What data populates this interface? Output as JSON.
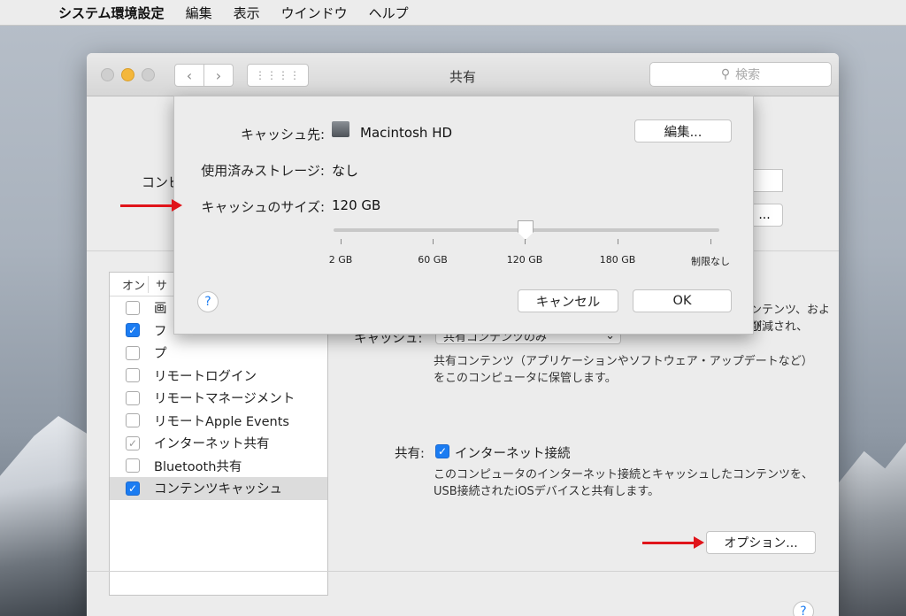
{
  "menubar": {
    "apple_icon": "apple-icon",
    "app_name": "システム環境設定",
    "items": [
      "編集",
      "表示",
      "ウインドウ",
      "ヘルプ"
    ]
  },
  "window": {
    "title": "共有",
    "search_placeholder": "検索",
    "computer_name_label": "コンピ",
    "edit_behind": "..."
  },
  "services": {
    "header_on": "オン",
    "header_service": "サ",
    "items": [
      {
        "label": "画",
        "checked": false
      },
      {
        "label": "フ",
        "checked": true
      },
      {
        "label": "プ",
        "checked": false
      },
      {
        "label": "リモートログイン",
        "checked": false
      },
      {
        "label": "リモートマネージメント",
        "checked": false
      },
      {
        "label": "リモートApple Events",
        "checked": false
      },
      {
        "label": "インターネット共有",
        "checked": true
      },
      {
        "label": "Bluetooth共有",
        "checked": false
      },
      {
        "label": "コンテンツキャッシュ",
        "checked": true
      }
    ]
  },
  "right_pane": {
    "desc_top_1": "ンテンツ、および",
    "desc_top_2": "削減され、",
    "cache_label": "キャッシュ:",
    "cache_popup": "共有コンテンツのみ",
    "cache_desc_1": "共有コンテンツ（アプリケーションやソフトウェア・アップデートなど）",
    "cache_desc_2": "をこのコンピュータに保管します。",
    "share_label": "共有:",
    "share_checkbox_label": "インターネット接続",
    "share_desc_1": "このコンピュータのインターネット接続とキャッシュしたコンテンツを、",
    "share_desc_2": "USB接続されたiOSデバイスと共有します。",
    "options_button": "オプション...",
    "help": "?"
  },
  "sheet": {
    "cache_dest_label": "キャッシュ先:",
    "cache_dest_value": "Macintosh HD",
    "edit_button": "編集...",
    "used_storage_label": "使用済みストレージ:",
    "used_storage_value": "なし",
    "cache_size_label": "キャッシュのサイズ:",
    "cache_size_value": "120 GB",
    "slider_ticks": [
      "2 GB",
      "60 GB",
      "120 GB",
      "180 GB",
      "制限なし"
    ],
    "slider_value": "120 GB",
    "help": "?",
    "cancel_button": "キャンセル",
    "ok_button": "OK"
  },
  "colors": {
    "accent": "#1b7cf2",
    "arrow": "#e0141a"
  }
}
